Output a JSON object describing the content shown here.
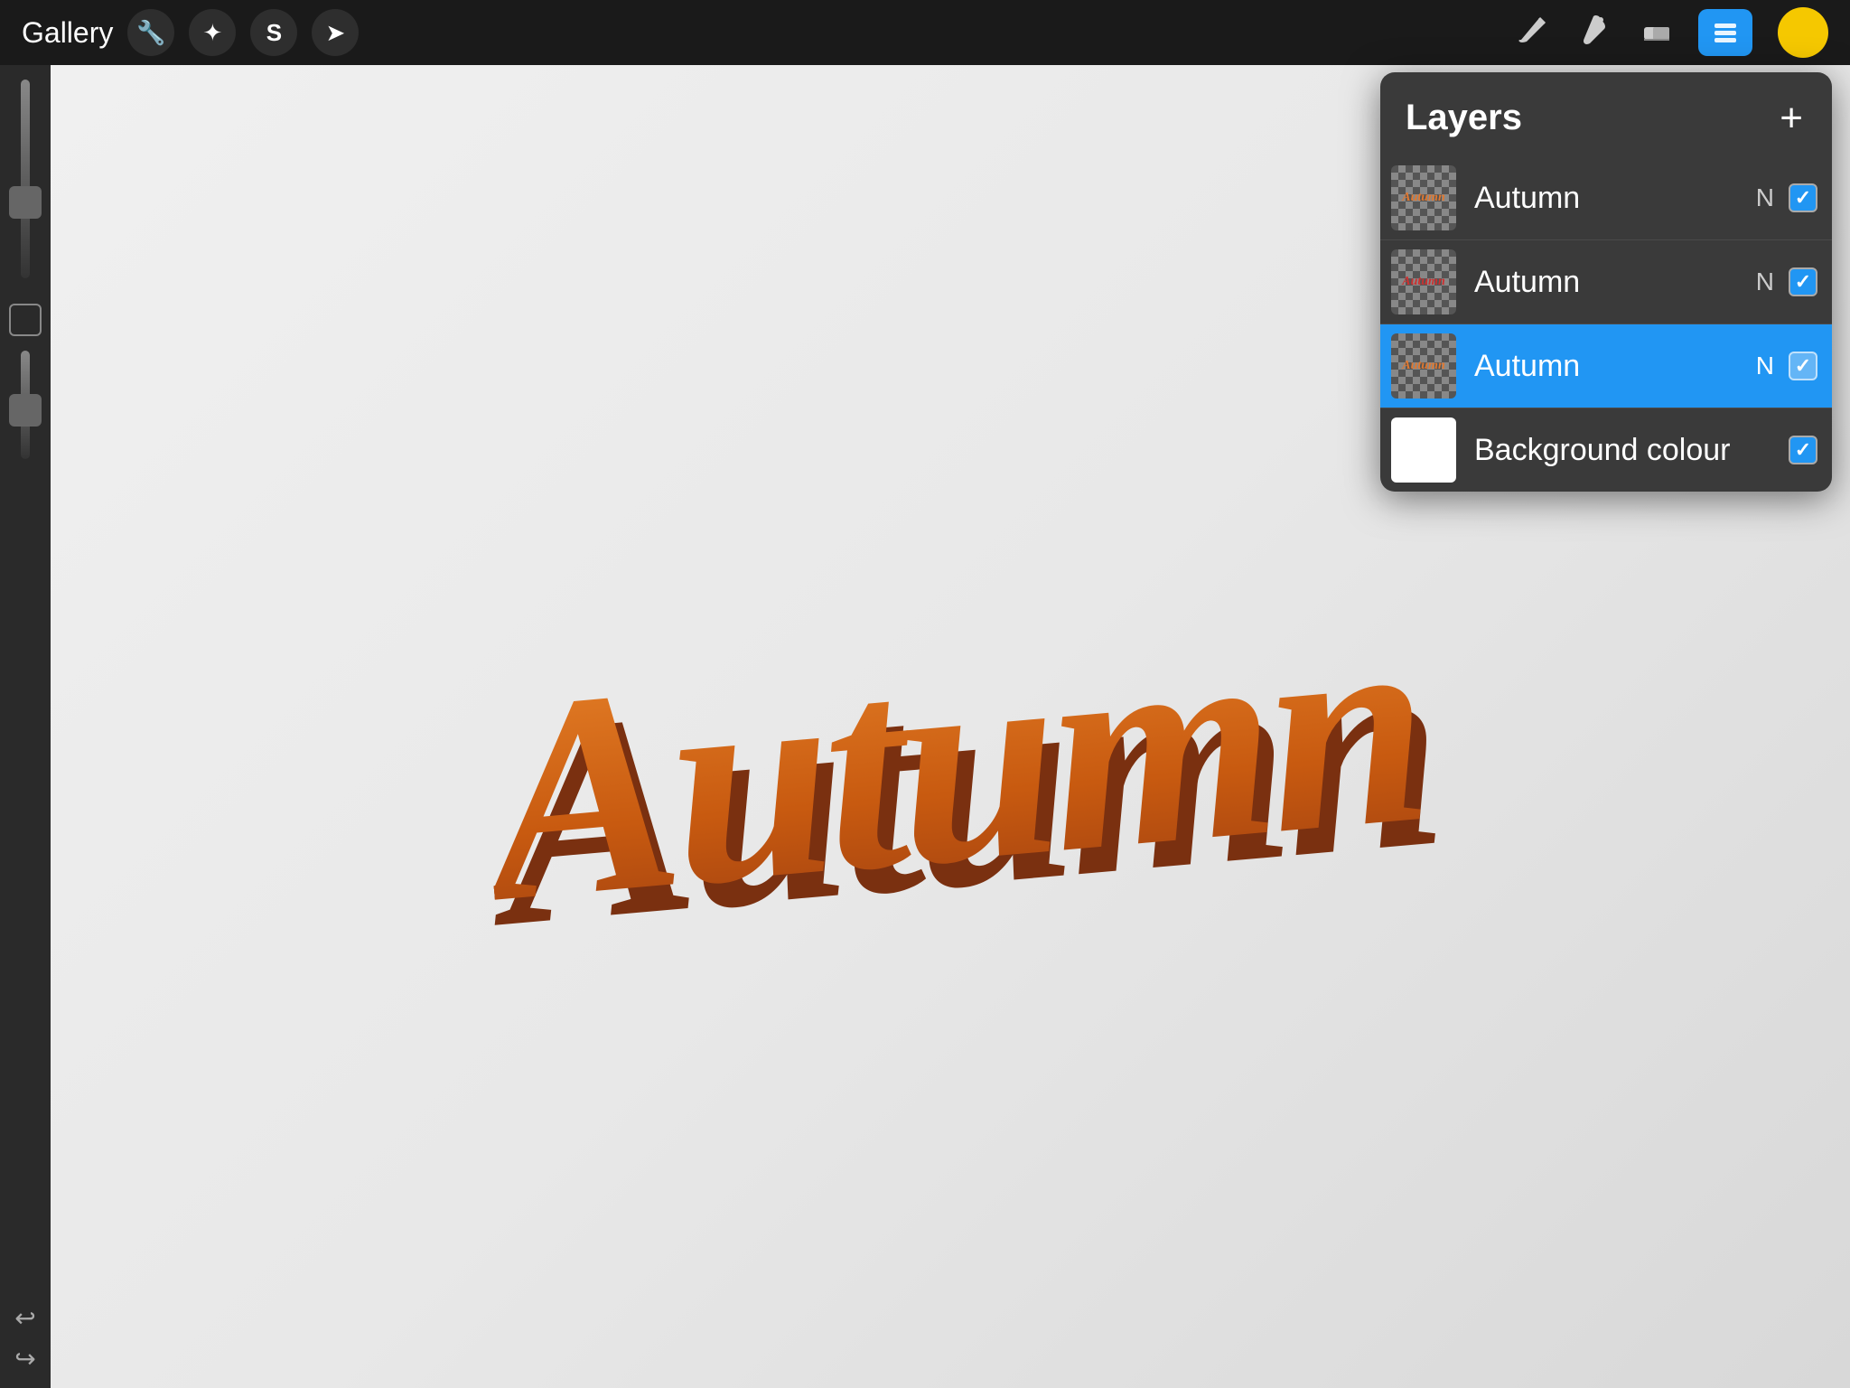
{
  "toolbar": {
    "gallery_label": "Gallery",
    "add_layer_label": "+",
    "layers_title": "Layers"
  },
  "tools": {
    "brush_icon": "✏",
    "smudge_icon": "✦",
    "eraser_icon": "◻",
    "undo_icon": "↩",
    "redo_icon": "↪"
  },
  "layers": [
    {
      "name": "Autumn",
      "blend": "N",
      "checked": true,
      "active": false,
      "thumb_type": "checker",
      "thumb_text": "Autumn",
      "thumb_color": "orange"
    },
    {
      "name": "Autumn",
      "blend": "N",
      "checked": true,
      "active": false,
      "thumb_type": "checker",
      "thumb_text": "Autumn",
      "thumb_color": "red"
    },
    {
      "name": "Autumn",
      "blend": "N",
      "checked": true,
      "active": true,
      "thumb_type": "checker",
      "thumb_text": "Autumn",
      "thumb_color": "orange"
    },
    {
      "name": "Background colour",
      "blend": "",
      "checked": true,
      "active": false,
      "thumb_type": "white",
      "thumb_text": "",
      "thumb_color": ""
    }
  ],
  "canvas": {
    "autumn_text": "Autumn"
  },
  "colors": {
    "active_tool": "#2196F3",
    "color_swatch": "#F5C800",
    "toolbar_bg": "#1a1a1a",
    "panel_bg": "#3a3a3a",
    "layer_active": "#2196F3"
  }
}
